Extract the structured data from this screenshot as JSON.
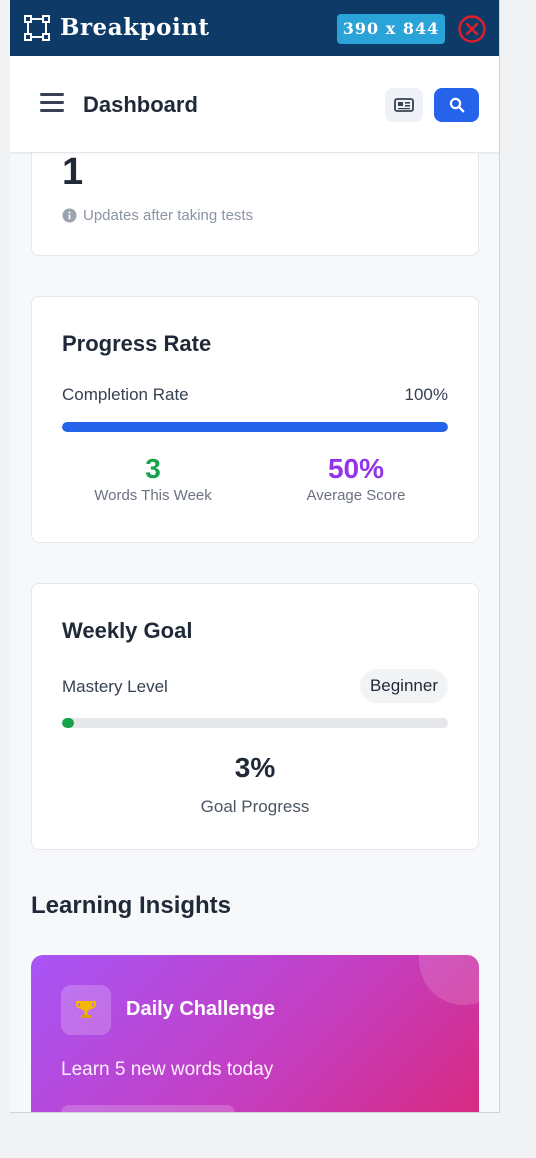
{
  "extension": {
    "name": "Breakpoint",
    "viewport_label": "390 x 844",
    "icons": {
      "logo": "bounding-box-icon",
      "close": "close-circle-icon"
    },
    "colors": {
      "bar": "#0d3a66",
      "badge": "#2aa3d9",
      "close": "#e11d2e"
    }
  },
  "header": {
    "title": "Dashboard",
    "icons": {
      "menu": "hamburger-icon",
      "card": "id-card-icon",
      "search": "search-icon"
    }
  },
  "stats_card": {
    "value": "1",
    "hint": "Updates after taking tests"
  },
  "progress_card": {
    "title": "Progress Rate",
    "completion_label": "Completion Rate",
    "completion_value": "100%",
    "completion_fraction": 1.0,
    "words_value": "3",
    "words_label": "Words This Week",
    "score_value": "50%",
    "score_label": "Average Score",
    "colors": {
      "bar": "#2563eb",
      "words": "#16a34a",
      "score": "#9333ea"
    }
  },
  "goal_card": {
    "title": "Weekly Goal",
    "mastery_label": "Mastery Level",
    "mastery_value": "Beginner",
    "goal_fraction": 0.03,
    "goal_value": "3%",
    "goal_label": "Goal Progress",
    "colors": {
      "bar": "#16a34a"
    }
  },
  "insights": {
    "title": "Learning Insights",
    "challenge": {
      "title": "Daily Challenge",
      "text": "Learn 5 new words today",
      "icon": "trophy-icon"
    }
  }
}
